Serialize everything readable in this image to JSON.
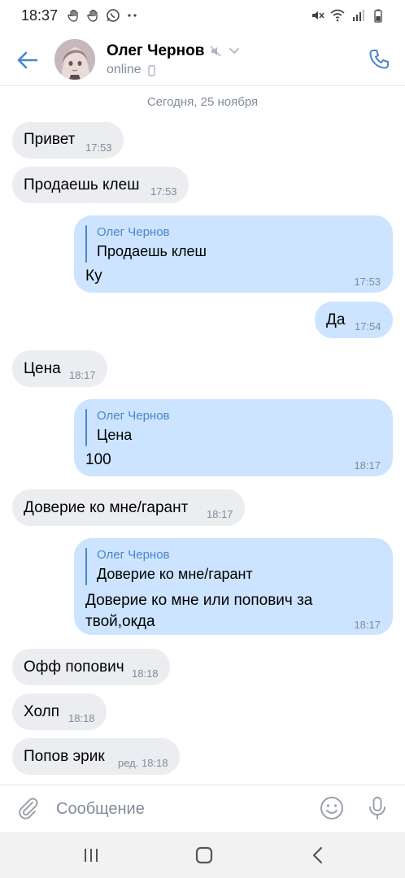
{
  "status_bar": {
    "time": "18:37",
    "left_icons": [
      "hand-icon",
      "hand-icon",
      "whatsapp-icon",
      "more-dots-icon"
    ],
    "right_icons": [
      "mute-icon",
      "wifi-icon",
      "signal-icon",
      "battery-icon"
    ]
  },
  "header": {
    "name": "Олег Чернов",
    "status": "online",
    "muted": true,
    "accent": "#4986cc"
  },
  "chat": {
    "date_separator": "Сегодня, 25 ноября",
    "messages": [
      {
        "dir": "in",
        "text": "Привет",
        "time": "17:53"
      },
      {
        "dir": "in",
        "text": "Продаешь клеш",
        "time": "17:53"
      },
      {
        "dir": "out",
        "reply_author": "Олег Чернов",
        "reply_text": "Продаешь клеш",
        "text": "Ку",
        "time": "17:53"
      },
      {
        "dir": "out",
        "text": "Да",
        "time": "17:54"
      },
      {
        "dir": "in",
        "text": "Цена",
        "time": "18:17"
      },
      {
        "dir": "out",
        "reply_author": "Олег Чернов",
        "reply_text": "Цена",
        "text": "100",
        "time": "18:17"
      },
      {
        "dir": "in",
        "text": "Доверие ко мне/гарант",
        "time": "18:17"
      },
      {
        "dir": "out",
        "reply_author": "Олег Чернов",
        "reply_text": "Доверие ко мне/гарант",
        "text": "Доверие ко мне или попович за\nтвой,окда",
        "time": "18:17"
      },
      {
        "dir": "in",
        "text": "Офф попович",
        "time": "18:18"
      },
      {
        "dir": "in",
        "text": "Холп",
        "time": "18:18"
      },
      {
        "dir": "in",
        "text": "Попов эрик",
        "time": "ред. 18:18"
      }
    ]
  },
  "composer": {
    "placeholder": "Сообщение"
  },
  "colors": {
    "incoming_bubble": "#ebedf0",
    "outgoing_bubble": "#cce4ff",
    "secondary_text": "#818c99"
  }
}
